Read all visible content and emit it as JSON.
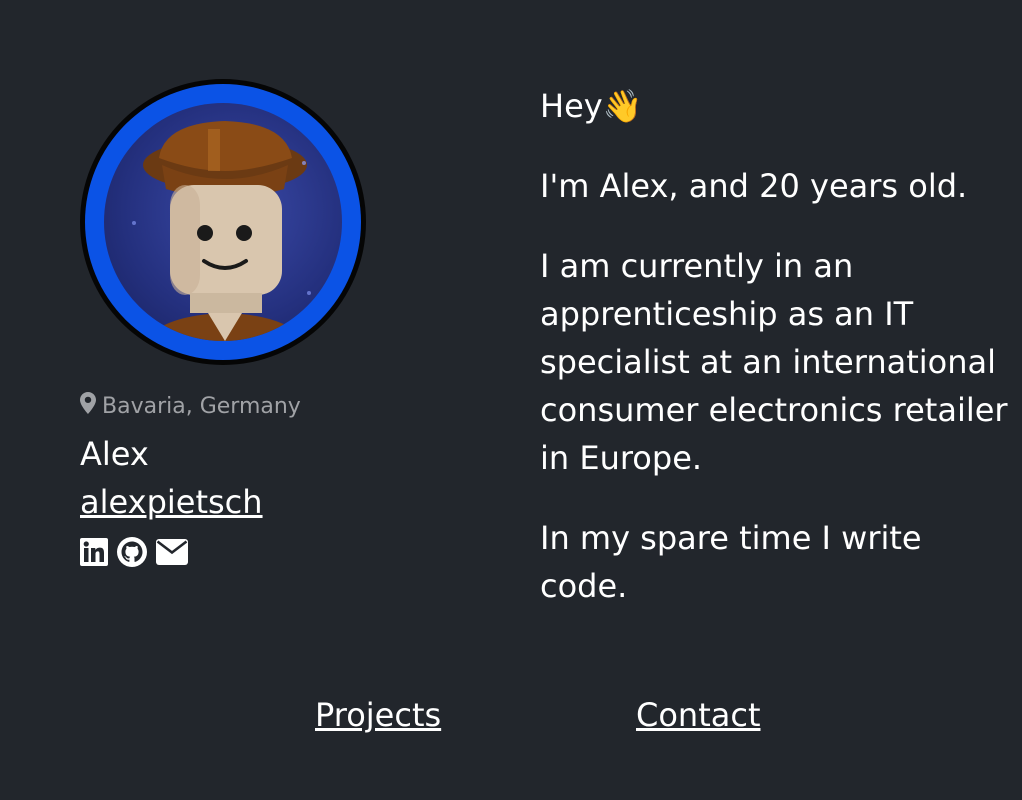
{
  "profile": {
    "location": "Bavaria, Germany",
    "name": "Alex",
    "username": "alexpietsch",
    "socials": [
      "linkedin-icon",
      "github-icon",
      "mail-icon"
    ]
  },
  "bio": {
    "greeting": "Hey👋",
    "intro": "I'm Alex, and 20 years old.",
    "work": "I am currently in an apprenticeship as an IT specialist at an international consumer electronics retailer in Europe.",
    "hobby": "In my spare time I write code."
  },
  "nav": {
    "projects": "Projects",
    "contact": "Contact"
  },
  "colors": {
    "background": "#22262c",
    "text": "#ffffff",
    "muted": "#a0a2a6",
    "avatar_ring": "#0b53e6"
  }
}
